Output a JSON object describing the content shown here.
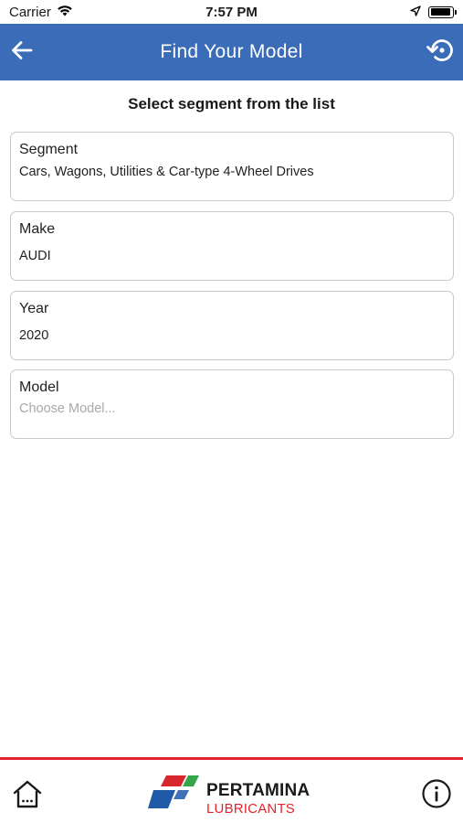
{
  "status_bar": {
    "carrier": "Carrier",
    "time": "7:57 PM",
    "battery_level": 0.95
  },
  "nav": {
    "title": "Find Your Model",
    "back_icon": "arrow-left-icon",
    "reset_icon": "history-reset-icon",
    "background_color": "#3b6cb7"
  },
  "instruction": "Select segment from the list",
  "fields": {
    "segment": {
      "label": "Segment",
      "value": "Cars, Wagons, Utilities & Car-type 4-Wheel Drives"
    },
    "make": {
      "label": "Make",
      "value": "AUDI"
    },
    "year": {
      "label": "Year",
      "value": "2020"
    },
    "model": {
      "label": "Model",
      "value": "",
      "placeholder": "Choose Model..."
    }
  },
  "footer": {
    "home_icon": "home-icon",
    "info_icon": "info-icon",
    "brand": "PERTAMINA",
    "brand_sub": "LUBRICANTS",
    "accent_color": "#e4232b"
  }
}
